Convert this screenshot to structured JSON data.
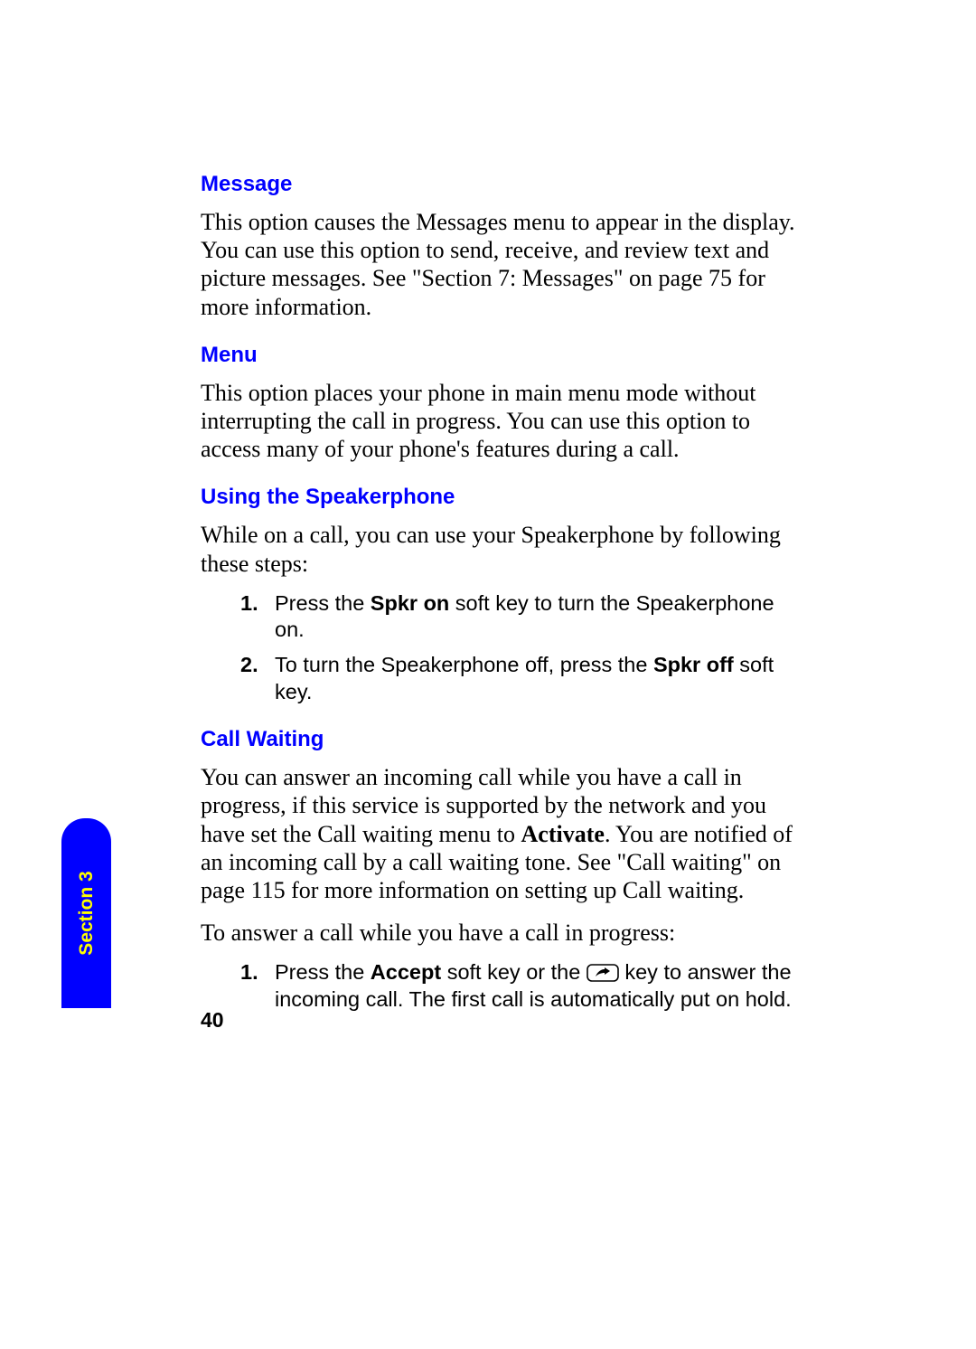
{
  "sections": {
    "message": {
      "heading": "Message",
      "para": "This option causes the Messages menu to appear in the display. You can use this option to send, receive, and review text and picture messages. See \"Section 7: Messages\" on page 75 for more information."
    },
    "menu": {
      "heading": "Menu",
      "para": "This option places your phone in main menu mode without interrupting the call in progress. You can use this option to access many of your phone's features during a call."
    },
    "speakerphone": {
      "heading": "Using the Speakerphone",
      "intro": "While on a call, you can use your Speakerphone by following these steps:",
      "steps": {
        "s1_marker": "1.",
        "s1_a": "Press the ",
        "s1_b_bold": "Spkr on",
        "s1_c": " soft key to turn the Speakerphone on.",
        "s2_marker": "2.",
        "s2_a": "To turn the Speakerphone off, press the ",
        "s2_b_bold": "Spkr off",
        "s2_c": " soft key."
      }
    },
    "callwaiting": {
      "heading": "Call Waiting",
      "para1_a": "You can answer an incoming call while you have a call in progress, if this service is supported by the network and you have set the Call waiting menu to ",
      "para1_b_bold": "Activate",
      "para1_c": ". You are notified of an incoming call by a call waiting tone. See \"Call waiting\" on page 115 for more information on setting up Call waiting.",
      "para2": "To answer a call while you have a call in progress:",
      "steps": {
        "s1_marker": "1.",
        "s1_a": "Press the ",
        "s1_b_bold": "Accept",
        "s1_c": " soft key or the ",
        "s1_d": " key to answer the incoming call. The first call is automatically put on hold."
      }
    }
  },
  "footer": {
    "section_tab": "Section 3",
    "page_number": "40"
  }
}
